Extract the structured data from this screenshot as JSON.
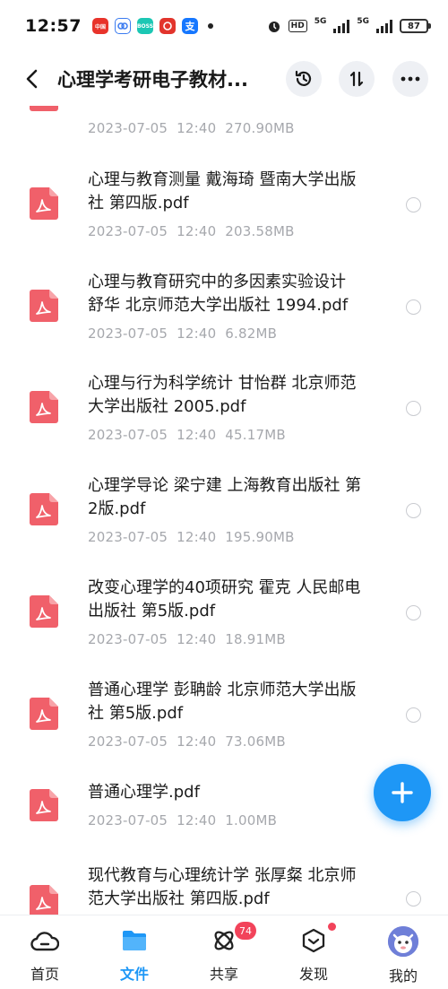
{
  "status_bar": {
    "time": "12:57",
    "app_icons": [
      {
        "name": "china-unicom-app-icon",
        "color": "#e8332b",
        "text": "中国"
      },
      {
        "name": "cloud-app-icon",
        "color": "#3b7bf0",
        "text": ""
      },
      {
        "name": "boss-app-icon",
        "color": "#1cc7b4",
        "text": "BOSS"
      },
      {
        "name": "netease-music-app-icon",
        "color": "#e2342c",
        "text": ""
      },
      {
        "name": "alipay-app-icon",
        "color": "#1677ff",
        "text": "支"
      }
    ],
    "network_1": "5G",
    "network_2": "5G",
    "hd": "HD",
    "battery": "87"
  },
  "header": {
    "title": "心理学考研电子教材..."
  },
  "partial_item": {
    "meta": "2023-07-05  12:40  270.90MB"
  },
  "files": [
    {
      "line1": "心理与教育测量 戴海琦 暨南大学出版",
      "line2": "社 第四版.pdf",
      "meta": "2023-07-05  12:40  203.58MB"
    },
    {
      "line1": "心理与教育研究中的多因素实验设计",
      "line2": "舒华 北京师范大学出版社 1994.pdf",
      "meta": "2023-07-05  12:40  6.82MB"
    },
    {
      "line1": "心理与行为科学统计 甘怡群 北京师范",
      "line2": "大学出版社 2005.pdf",
      "meta": "2023-07-05  12:40  45.17MB"
    },
    {
      "line1": "心理学导论 梁宁建 上海教育出版社 第",
      "line2": "2版.pdf",
      "meta": "2023-07-05  12:40  195.90MB"
    },
    {
      "line1": "改变心理学的40项研究 霍克 人民邮电",
      "line2": "出版社 第5版.pdf",
      "meta": "2023-07-05  12:40  18.91MB"
    },
    {
      "line1": "普通心理学 彭聃龄 北京师范大学出版",
      "line2": "社 第5版.pdf",
      "meta": "2023-07-05  12:40  73.06MB"
    },
    {
      "line1": "普通心理学.pdf",
      "line2": "",
      "meta": "2023-07-05  12:40  1.00MB"
    },
    {
      "line1": "现代教育与心理统计学 张厚粲 北京师",
      "line2": "范大学出版社 第四版.pdf",
      "meta": ""
    }
  ],
  "bottom_nav": {
    "home": "首页",
    "files": "文件",
    "share": "共享",
    "share_badge": "74",
    "discover": "发现",
    "mine": "我的"
  },
  "colors": {
    "accent": "#1e97f6",
    "pdf_red": "#f0606a",
    "badge_red": "#f2435a",
    "meta_gray": "#a6a8ad"
  }
}
